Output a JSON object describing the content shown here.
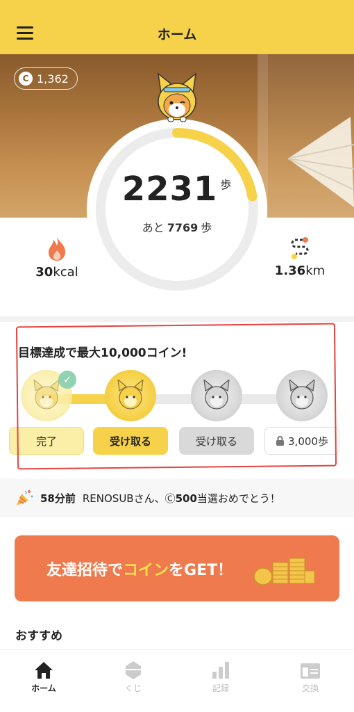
{
  "header": {
    "title": "ホーム",
    "menu_icon": "menu-icon"
  },
  "hero": {
    "coin_balance": "1,362",
    "coin_symbol": "C"
  },
  "progress": {
    "steps": "2231",
    "steps_unit": "歩",
    "remain_prefix": "あと",
    "remain_value": "7769",
    "remain_unit": "歩",
    "fraction": 0.2231,
    "accent_color": "#f6d24a"
  },
  "stats": {
    "calories_value": "30",
    "calories_unit": "kcal",
    "distance_value": "1.36",
    "distance_unit": "km"
  },
  "goal": {
    "title": "目標達成で最大10,000コイン!",
    "buttons": [
      {
        "label": "完了",
        "state": "done"
      },
      {
        "label": "受け取る",
        "state": "active"
      },
      {
        "label": "受け取る",
        "state": "locked"
      },
      {
        "label": "3,000歩",
        "state": "locked"
      }
    ]
  },
  "news": {
    "time": "58分前",
    "text_before": "RENOSUBさん、",
    "coin_symbol": "Ⓒ",
    "amount": "500",
    "text_after": "当選おめでとう！"
  },
  "banner": {
    "part1": "友達招待で",
    "highlight": "コイン",
    "part2": "をGET！"
  },
  "recommend": {
    "title": "おすすめ"
  },
  "tabs": [
    {
      "label": "ホーム",
      "icon": "home-icon",
      "active": true
    },
    {
      "label": "くじ",
      "icon": "lottery-icon",
      "active": false
    },
    {
      "label": "記録",
      "icon": "chart-icon",
      "active": false
    },
    {
      "label": "交換",
      "icon": "exchange-icon",
      "active": false
    }
  ]
}
